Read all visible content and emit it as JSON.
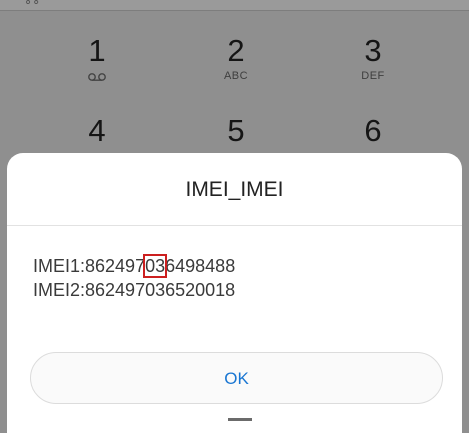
{
  "status": {
    "top_glyph": "∘∘"
  },
  "keypad": [
    {
      "digit": "1",
      "sub": "",
      "icon": "voicemail-icon"
    },
    {
      "digit": "2",
      "sub": "ABC"
    },
    {
      "digit": "3",
      "sub": "DEF"
    },
    {
      "digit": "4",
      "sub": ""
    },
    {
      "digit": "5",
      "sub": ""
    },
    {
      "digit": "6",
      "sub": ""
    }
  ],
  "dialog": {
    "title": "IMEI_IMEI",
    "imei1_prefix": "IMEI1:86249",
    "imei1_digit_before": "7",
    "imei1_highlight": "03",
    "imei1_suffix": "6498488",
    "imei2": "IMEI2:862497036520018",
    "ok_label": "OK"
  },
  "colors": {
    "accent": "#1976d2",
    "highlight_box": "#cc1f1f"
  }
}
